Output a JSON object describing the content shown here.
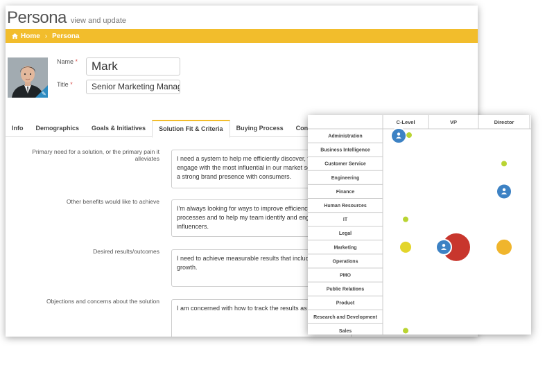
{
  "header": {
    "title": "Persona",
    "subtitle": "view and update"
  },
  "breadcrumb": {
    "home": "Home",
    "separator": "›",
    "current": "Persona"
  },
  "profile": {
    "name_label": "Name",
    "required_mark": "*",
    "name_value": "Mark",
    "title_label": "Title",
    "title_value": "Senior Marketing Manager"
  },
  "tabs": [
    {
      "label": "Info",
      "active": false
    },
    {
      "label": "Demographics",
      "active": false
    },
    {
      "label": "Goals & Initiatives",
      "active": false
    },
    {
      "label": "Solution Fit & Criteria",
      "active": true
    },
    {
      "label": "Buying Process",
      "active": false
    },
    {
      "label": "Content",
      "active": false
    }
  ],
  "questions": [
    {
      "label": "Primary need for a solution, or the primary pain it alleviates",
      "answer": "I need a system to help me efficiently discover, track and engage with the most influential in our market so I can build a strong brand presence with consumers."
    },
    {
      "label": "Other benefits would like to achieve",
      "answer": "I'm always looking for ways to improve efficiency in our processes and to help my team identify and engage with influencers."
    },
    {
      "label": "Desired results/outcomes",
      "answer": "I need to achieve measurable results that include audience growth."
    },
    {
      "label": "Objections and concerns about the solution",
      "answer": "I am concerned with how to track the results as well."
    }
  ],
  "chart_data": {
    "type": "scatter",
    "columns": [
      "C-Level",
      "VP",
      "Director"
    ],
    "rows": [
      "Administration",
      "Business Intelligence",
      "Customer Service",
      "Engineering",
      "Finance",
      "Human Resources",
      "IT",
      "Legal",
      "Marketing",
      "Operations",
      "PMO",
      "Public Relations",
      "Product",
      "Research and Development",
      "Sales"
    ],
    "colors": {
      "persona": "#3d82c4",
      "small": "#b9d432",
      "medium": "#e3d52b",
      "large": "#c8362d",
      "orange": "#f0b52c"
    },
    "bubbles": [
      {
        "row": "Administration",
        "col": "C-Level",
        "kind": "persona",
        "size": 3
      },
      {
        "row": "Administration",
        "col": "C-Level",
        "kind": "small",
        "size": 1
      },
      {
        "row": "Customer Service",
        "col": "Director",
        "kind": "small",
        "size": 1
      },
      {
        "row": "Finance",
        "col": "Director",
        "kind": "persona",
        "size": 3
      },
      {
        "row": "IT",
        "col": "C-Level",
        "kind": "small",
        "size": 1
      },
      {
        "row": "Marketing",
        "col": "C-Level",
        "kind": "medium",
        "size": 2
      },
      {
        "row": "Marketing",
        "col": "VP",
        "kind": "large",
        "size": 5
      },
      {
        "row": "Marketing",
        "col": "VP",
        "kind": "persona",
        "size": 3
      },
      {
        "row": "Marketing",
        "col": "Director",
        "kind": "orange",
        "size": 3
      },
      {
        "row": "Sales",
        "col": "C-Level",
        "kind": "small",
        "size": 1
      }
    ]
  }
}
